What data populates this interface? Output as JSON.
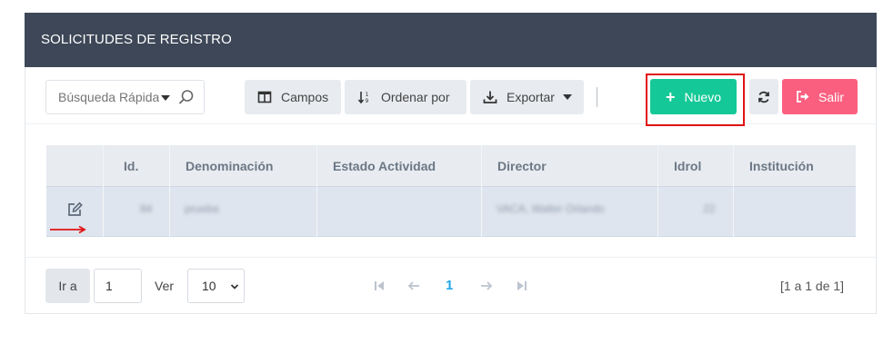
{
  "panel": {
    "title": "SOLICITUDES DE REGISTRO"
  },
  "toolbar": {
    "search_placeholder": "Búsqueda Rápida",
    "campos_label": "Campos",
    "ordenar_label": "Ordenar por",
    "exportar_label": "Exportar",
    "nuevo_label": "Nuevo",
    "salir_label": "Salir"
  },
  "table": {
    "columns": [
      "",
      "Id.",
      "Denominación",
      "Estado Actividad",
      "Director",
      "Idrol",
      "Institución"
    ],
    "rows": [
      {
        "id": "84",
        "denominacion": "prueba",
        "estado": "",
        "director": "VACA, Walter Orlando",
        "idrol": "22",
        "institucion": ""
      }
    ]
  },
  "footer": {
    "go_to_label": "Ir a",
    "page_input_value": "1",
    "ver_label": "Ver",
    "page_size": "10",
    "current_page": "1",
    "page_info": "[1 a 1 de 1]"
  },
  "colors": {
    "header_bg": "#3d4757",
    "nuevo_bg": "#14c997",
    "salir_bg": "#fb5f7f",
    "highlight": "#e01414",
    "page_accent": "#1ea7e8"
  },
  "icons": {
    "search": "search-icon",
    "campos": "columns-icon",
    "ordenar": "sort-icon",
    "exportar": "download-icon",
    "refresh": "refresh-icon",
    "salir": "sign-out-icon",
    "edit": "edit-icon"
  }
}
